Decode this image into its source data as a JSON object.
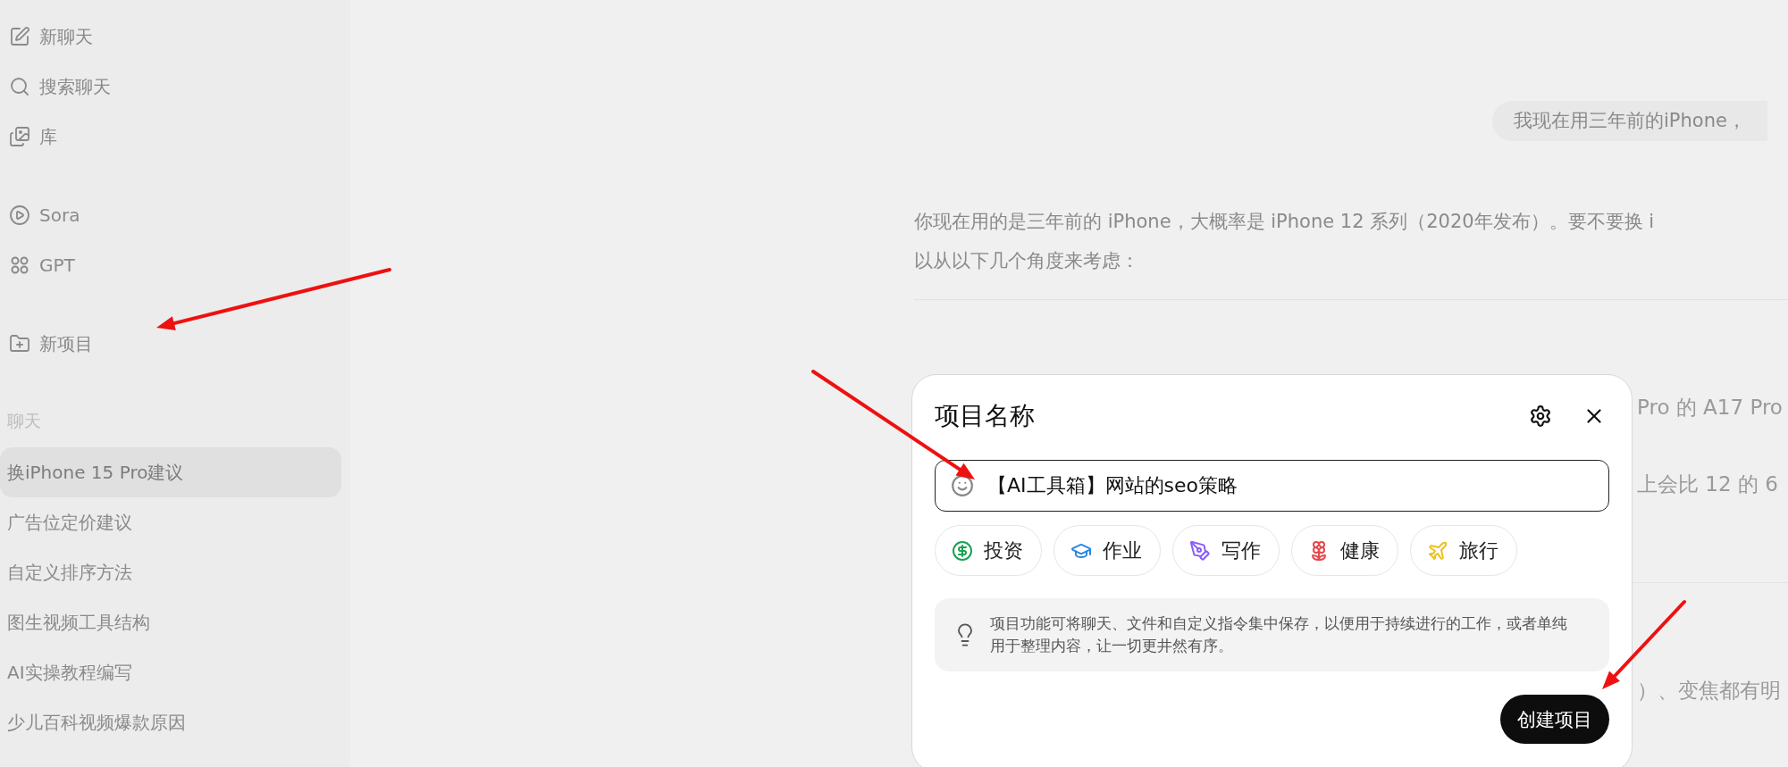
{
  "sidebar": {
    "nav_groups": [
      [
        {
          "kind": "compose",
          "label": "新聊天"
        },
        {
          "kind": "search",
          "label": "搜索聊天"
        },
        {
          "kind": "library",
          "label": "库"
        }
      ],
      [
        {
          "kind": "play",
          "label": "Sora"
        },
        {
          "kind": "grid",
          "label": "GPT"
        }
      ],
      [
        {
          "kind": "folder-plus",
          "label": "新项目"
        }
      ]
    ],
    "section_label": "聊天",
    "chats": [
      {
        "title": "换iPhone 15 Pro建议",
        "selected": true
      },
      {
        "title": "广告位定价建议",
        "selected": false
      },
      {
        "title": "自定义排序方法",
        "selected": false
      },
      {
        "title": "图生视频工具结构",
        "selected": false
      },
      {
        "title": "AI实操教程编写",
        "selected": false
      },
      {
        "title": "少儿百科视频爆款原因",
        "selected": false
      }
    ]
  },
  "conversation": {
    "user_message": "我现在用三年前的iPhone，",
    "reply_lines": [
      "你现在用的是三年前的 iPhone，大概率是 iPhone 12 系列（2020年发布）。要不要换 i",
      "以从以下几个角度来考虑："
    ],
    "hidden_fragments": [
      "Pro 的 A17 Pro",
      "上会比 12 的 6",
      "）、变焦都有明"
    ]
  },
  "dialog": {
    "title": "项目名称",
    "name_field": {
      "value": "【AI工具箱】网站的seo策略"
    },
    "categories": [
      {
        "kind": "money",
        "label": "投资",
        "color": "#1aa152"
      },
      {
        "kind": "school",
        "label": "作业",
        "color": "#2a86e0"
      },
      {
        "kind": "pen",
        "label": "写作",
        "color": "#8b5cf6"
      },
      {
        "kind": "health",
        "label": "健康",
        "color": "#e5484d"
      },
      {
        "kind": "travel",
        "label": "旅行",
        "color": "#eebf1a"
      }
    ],
    "tip": "项目功能可将聊天、文件和自定义指令集中保存，以便用于持续进行的工作，或者单纯用于整理内容，让一切更井然有序。",
    "create_button": "创建项目"
  }
}
